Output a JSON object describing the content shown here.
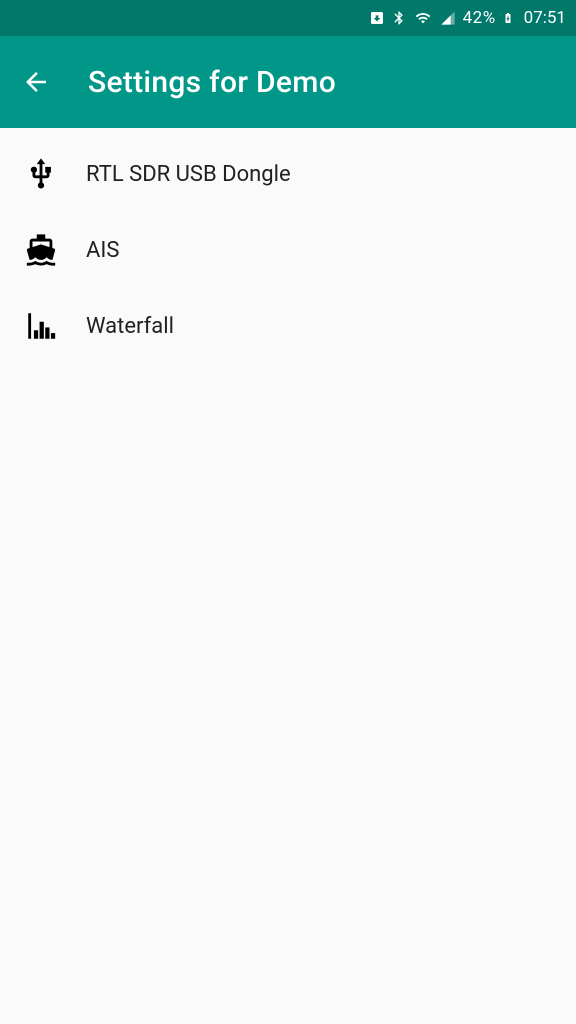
{
  "statusbar": {
    "battery_percent": "42%",
    "time": "07:51"
  },
  "appbar": {
    "title": "Settings for Demo"
  },
  "settings": {
    "items": [
      {
        "label": "RTL SDR USB Dongle",
        "icon": "usb-icon"
      },
      {
        "label": "AIS",
        "icon": "ship-icon"
      },
      {
        "label": "Waterfall",
        "icon": "equalizer-icon"
      }
    ]
  }
}
